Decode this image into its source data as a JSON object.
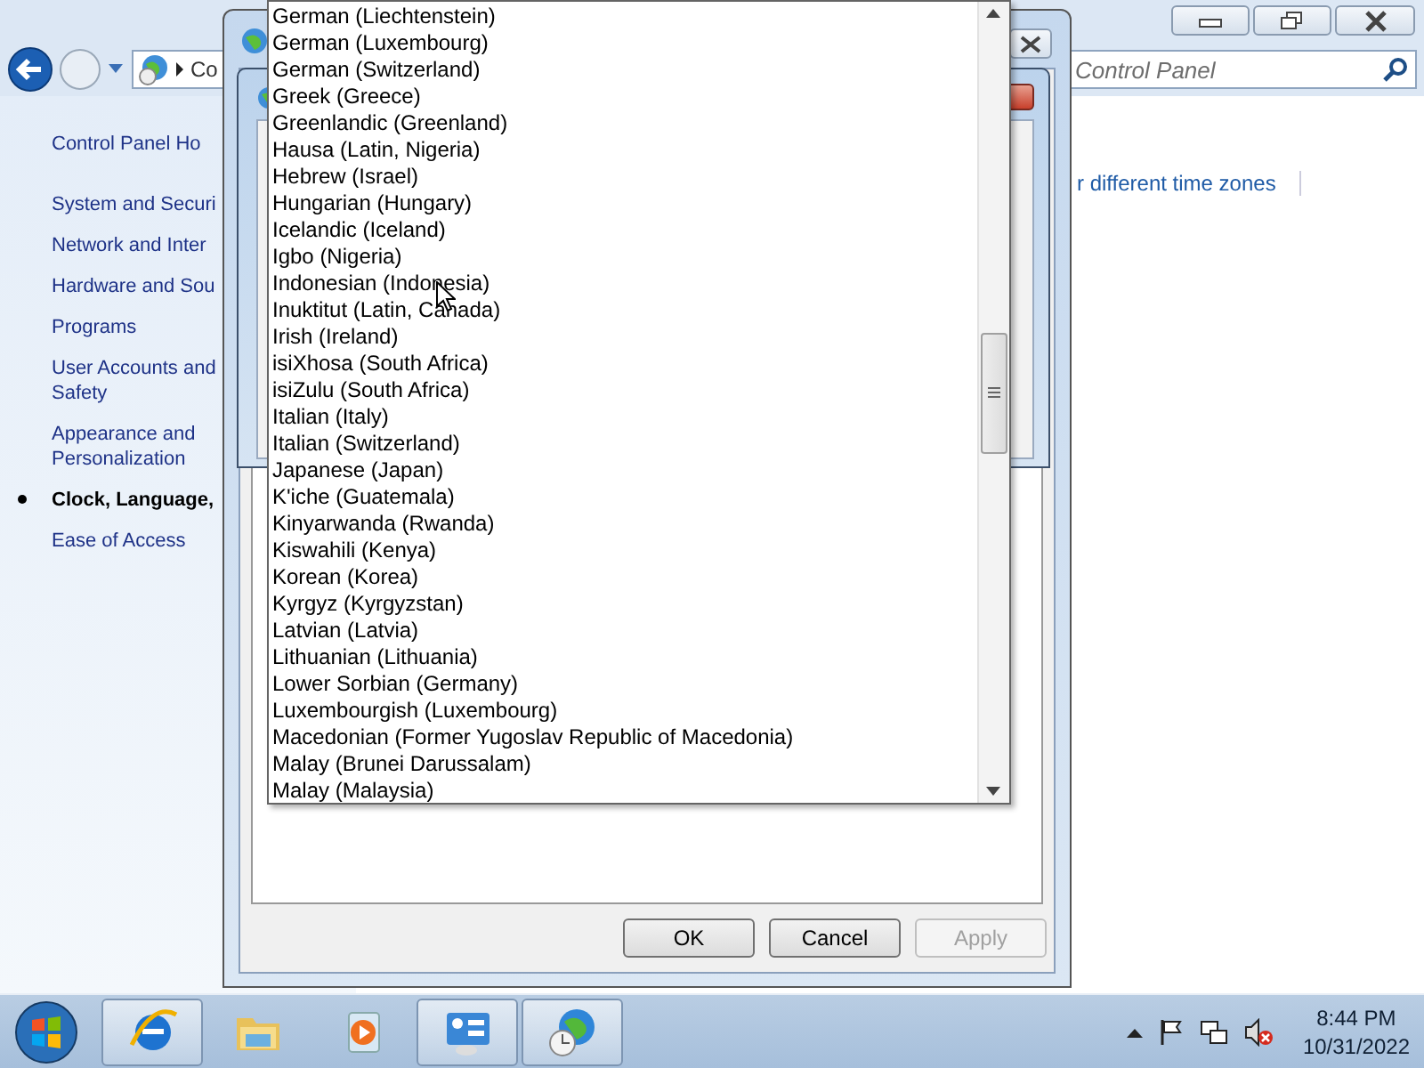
{
  "explorer": {
    "address": "Co",
    "search": {
      "placeholder": "Control Panel"
    },
    "sidebar": {
      "items": [
        {
          "label": "Control Panel Ho",
          "selected": false
        },
        {
          "label": "System and Securi",
          "selected": false
        },
        {
          "label": "Network and Inter",
          "selected": false
        },
        {
          "label": "Hardware and Sou",
          "selected": false
        },
        {
          "label": "Programs",
          "selected": false
        },
        {
          "label": "User Accounts and Safety",
          "selected": false
        },
        {
          "label": "Appearance and Personalization",
          "selected": false
        },
        {
          "label": "Clock, Language,",
          "selected": true
        },
        {
          "label": "Ease of Access",
          "selected": false
        }
      ]
    },
    "content_link": "r different time zones"
  },
  "region_dialog": {
    "language_list": {
      "items": [
        "German (Liechtenstein)",
        "German (Luxembourg)",
        "German (Switzerland)",
        "Greek (Greece)",
        "Greenlandic (Greenland)",
        "Hausa (Latin, Nigeria)",
        "Hebrew (Israel)",
        "Hungarian (Hungary)",
        "Icelandic (Iceland)",
        "Igbo (Nigeria)",
        "Indonesian (Indonesia)",
        "Inuktitut (Latin, Canada)",
        "Irish (Ireland)",
        "isiXhosa (South Africa)",
        "isiZulu (South Africa)",
        "Italian (Italy)",
        "Italian (Switzerland)",
        "Japanese (Japan)",
        "K'iche (Guatemala)",
        "Kinyarwanda (Rwanda)",
        "Kiswahili (Kenya)",
        "Korean (Korea)",
        "Kyrgyz (Kyrgyzstan)",
        "Latvian (Latvia)",
        "Lithuanian (Lithuania)",
        "Lower Sorbian (Germany)",
        "Luxembourgish (Luxembourg)",
        "Macedonian (Former Yugoslav Republic of Macedonia)",
        "Malay (Brunei Darussalam)",
        "Malay (Malaysia)"
      ]
    },
    "buttons": [
      {
        "label": "OK",
        "disabled": false
      },
      {
        "label": "Cancel",
        "disabled": false
      },
      {
        "label": "Apply",
        "disabled": true
      }
    ]
  },
  "taskbar": {
    "apps": [
      {
        "kind": "browser",
        "running": true
      },
      {
        "kind": "folder",
        "running": false
      },
      {
        "kind": "media",
        "running": false
      },
      {
        "kind": "panel",
        "running": true
      },
      {
        "kind": "globe",
        "running": true
      }
    ],
    "clock": {
      "time": "8:44 PM",
      "date": "10/31/2022"
    }
  }
}
